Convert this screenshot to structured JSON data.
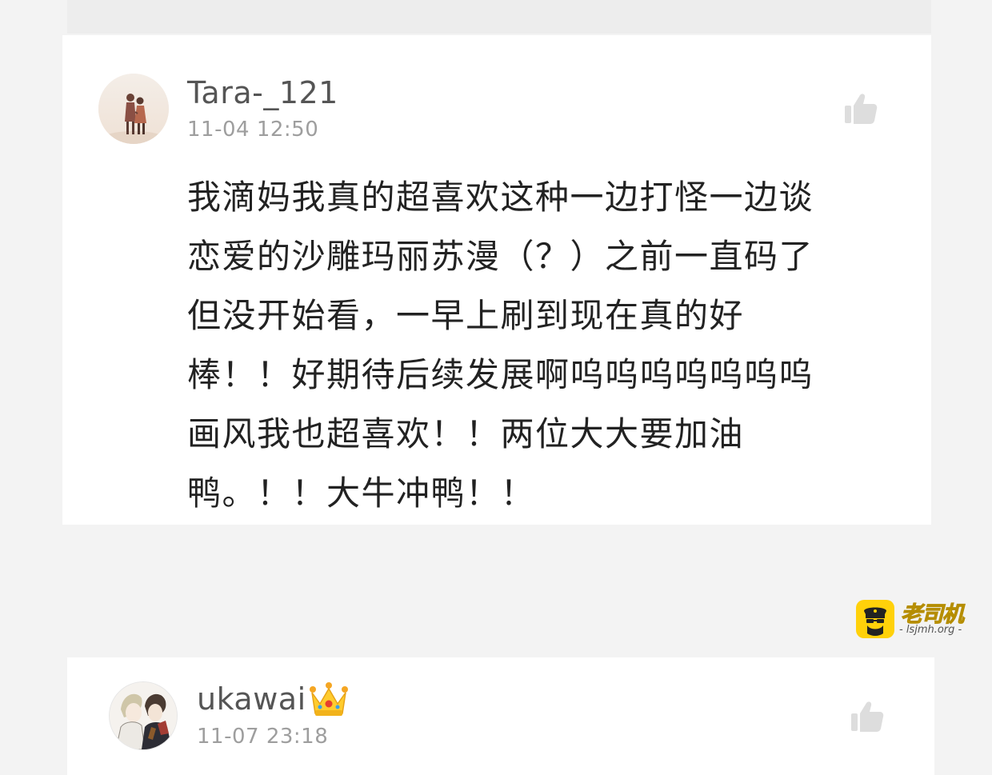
{
  "comments": [
    {
      "username": "Tara-_121",
      "timestamp": "11-04 12:50",
      "avatar_icon": "avatar-couple-illustration",
      "like_icon": "thumbs-up-icon",
      "lines": [
        "我滴妈我真的超喜欢这种一边打怪一边谈",
        "恋爱的沙雕玛丽苏漫（？）之前一直码了",
        "但没开始看，一早上刷到现在真的好",
        "棒！！好期待后续发展啊呜呜呜呜呜呜呜",
        "画风我也超喜欢！！两位大大要加油",
        "鸭。！！大牛冲鸭！！"
      ]
    },
    {
      "username": "ukawai",
      "timestamp": "11-07 23:18",
      "avatar_icon": "avatar-anime-characters",
      "badge_icon": "crown-icon",
      "like_icon": "thumbs-up-icon"
    }
  ],
  "watermark": {
    "brand": "老司机",
    "domain": "- lsjmh.org -",
    "icon": "driver-mascot-icon",
    "brand_color": "#ffd10a"
  },
  "colors": {
    "background": "#f3f3f3",
    "card": "#ffffff",
    "username": "#555555",
    "timestamp": "#9e9e9e",
    "text": "#222222",
    "like_icon": "#dddddd"
  }
}
